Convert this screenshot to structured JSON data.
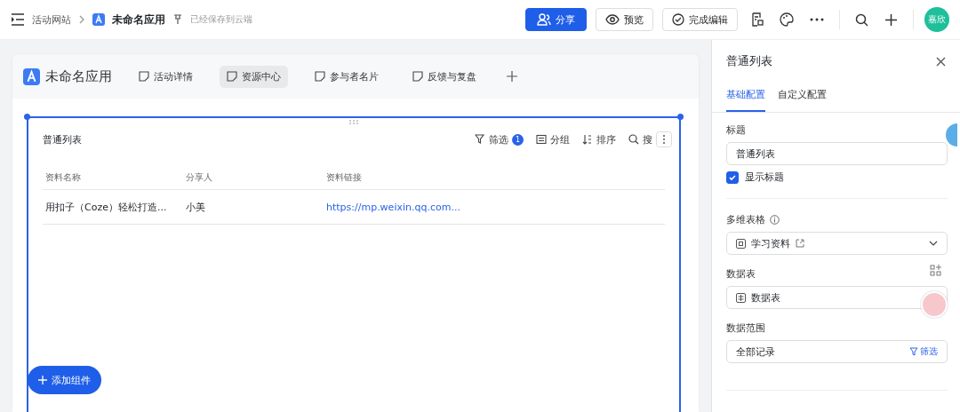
{
  "topbar": {
    "breadcrumb": "活动网站",
    "app_name": "未命名应用",
    "save_status": "已经保存到云端",
    "buttons": [
      {
        "kind": "primary",
        "label": "分享"
      },
      {
        "kind": "preview",
        "label": "预览"
      },
      {
        "kind": "done",
        "label": "完成编辑"
      }
    ],
    "avatar": "嘉欣"
  },
  "app": {
    "title": "未命名应用",
    "pages": [
      {
        "label": "活动详情",
        "selected": false
      },
      {
        "label": "资源中心",
        "selected": true
      },
      {
        "label": "参与者名片",
        "selected": false
      },
      {
        "label": "反馈与复盘",
        "selected": false
      }
    ]
  },
  "list": {
    "title": "普通列表",
    "tools": [
      {
        "kind": "filter",
        "label": "筛选",
        "badge": "1"
      },
      {
        "kind": "group",
        "label": "分组"
      },
      {
        "kind": "sort",
        "label": "排序"
      },
      {
        "kind": "search",
        "label": "搜"
      }
    ],
    "columns": [
      "资料名称",
      "分享人",
      "资料链接"
    ],
    "rows": [
      {
        "cells": [
          "用扣子（Coze）轻松打造...",
          "小美",
          "https://mp.weixin.qq.com..."
        ]
      }
    ]
  },
  "add_button": "添加组件",
  "panel": {
    "title": "普通列表",
    "tabs": [
      {
        "label": "基础配置",
        "selected": true
      },
      {
        "label": "自定义配置",
        "selected": false
      }
    ],
    "title_label": "标题",
    "title_value": "普通列表",
    "show_title": {
      "label": "显示标题",
      "checked": true
    },
    "table_label": "多维表格",
    "table_value": "学习资料",
    "sheet_label": "数据表",
    "sheet_value": "数据表",
    "range_label": "数据范围",
    "range_value": "全部记录",
    "range_filter": "筛选"
  }
}
